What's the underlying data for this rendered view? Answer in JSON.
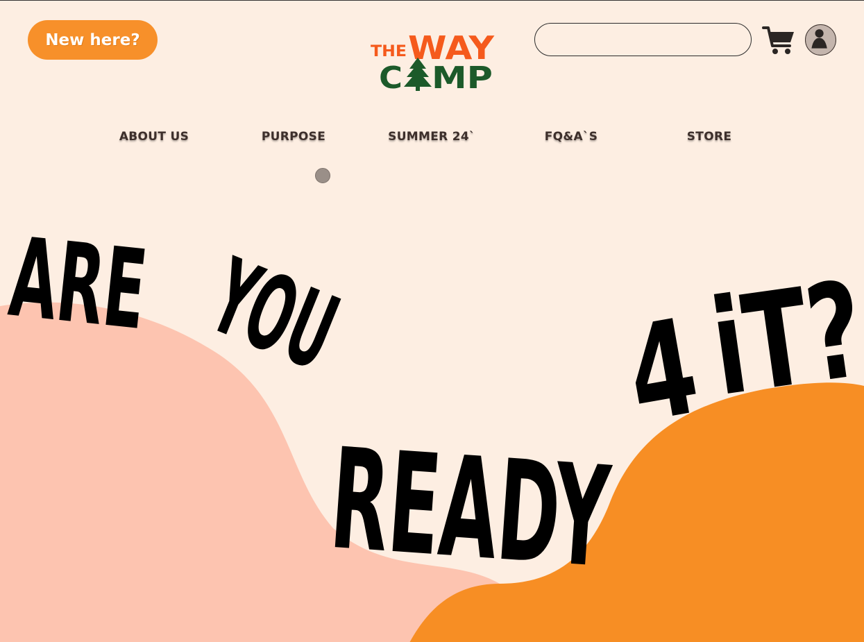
{
  "header": {
    "new_here_label": "New here?",
    "logo": {
      "line1_small": "THE",
      "line1_big": "WAY",
      "line2_left": "C",
      "line2_right": "MP"
    },
    "search_placeholder": "",
    "cart_icon": "cart-icon",
    "avatar_icon": "user-avatar-icon"
  },
  "nav": {
    "items": [
      "ABOUT US",
      "PURPOSE",
      "SUMMER 24`",
      "FQ&A`S",
      "STORE"
    ]
  },
  "hero": {
    "words": [
      "ARE",
      "YOU",
      "READY",
      "4",
      "iT?"
    ]
  },
  "colors": {
    "background": "#fdeee2",
    "accent_orange": "#f7902a",
    "logo_orange": "#f55a1c",
    "logo_green": "#1c5a2a",
    "hill_pink": "#fdc4b0",
    "hill_orange": "#f78e24",
    "text_dark": "#3d2f2b"
  }
}
